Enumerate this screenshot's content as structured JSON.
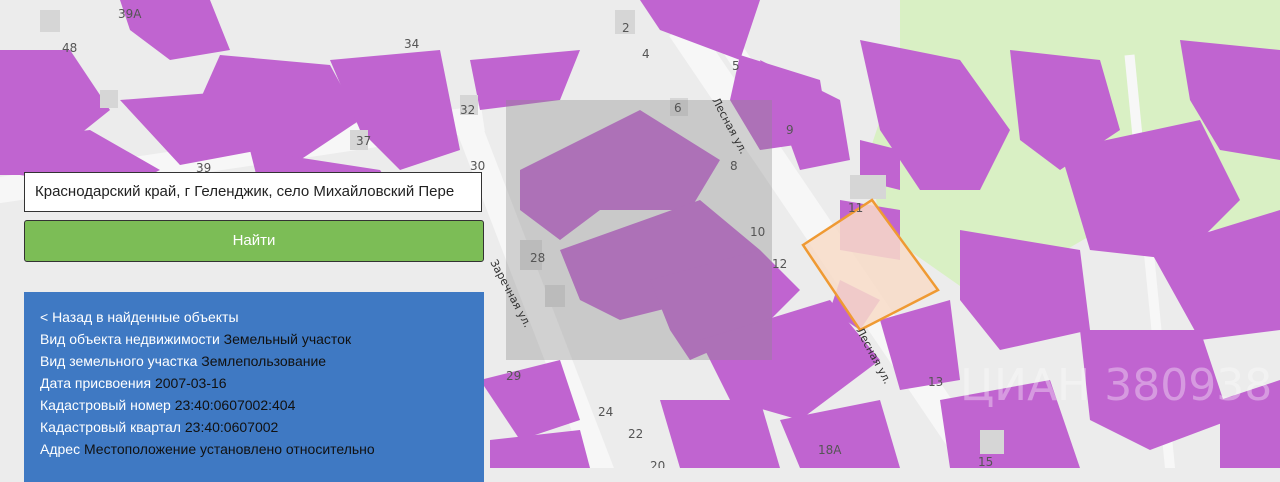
{
  "search": {
    "query": "Краснодарский край, г Геленджик, село Михайловский Пере",
    "button_label": "Найти"
  },
  "info": {
    "back_label": "< Назад в найденные объекты",
    "rows": [
      {
        "label": "Вид объекта недвижимости",
        "value": "Земельный участок"
      },
      {
        "label": "Вид земельного участка",
        "value": "Землепользование"
      },
      {
        "label": "Дата присвоения",
        "value": "2007-03-16"
      },
      {
        "label": "Кадастровый номер",
        "value": "23:40:0607002:404"
      },
      {
        "label": "Кадастровый квартал",
        "value": "23:40:0607002"
      },
      {
        "label": "Адрес",
        "value": "Местоположение установлено относительно"
      }
    ]
  },
  "map": {
    "colors": {
      "background": "#ececec",
      "parcel": "#c064d0",
      "green_zone": "#d9f0c4",
      "highlight_fill": "#f8dcc8",
      "highlight_stroke": "#ef9a33",
      "building": "#d8d8d8"
    },
    "house_numbers": [
      "39А",
      "48",
      "34",
      "2",
      "4",
      "5",
      "6",
      "32",
      "37",
      "39",
      "30",
      "9",
      "8",
      "11",
      "10",
      "28",
      "12",
      "29",
      "24",
      "22",
      "13",
      "18А",
      "15",
      "20"
    ],
    "streets": [
      "Лесная ул.",
      "Лесная ул.",
      "Заречная ул."
    ],
    "watermark": "ЦИАН 380938"
  }
}
